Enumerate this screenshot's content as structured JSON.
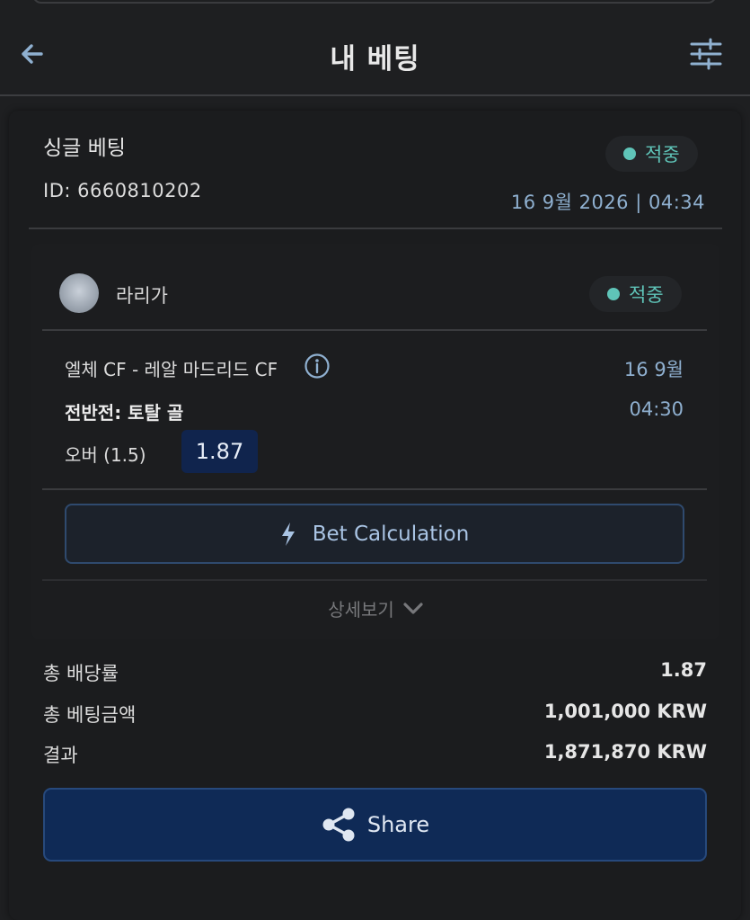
{
  "header": {
    "title": "내 베팅"
  },
  "bet": {
    "type": "싱글 베팅",
    "id": "ID: 6660810202",
    "status": "적중",
    "date": "16 9월 2026 | 04:34",
    "status_color": "#5fc4b8"
  },
  "event": {
    "league": "라리가",
    "status": "적중",
    "match": "엘체 CF - 레알 마드리드 CF",
    "date": "16 9월",
    "market": "전반전: 토탈 골",
    "time": "04:30",
    "selection": "오버 (1.5)",
    "odds": "1.87",
    "calc_label": "Bet Calculation",
    "details_label": "상세보기"
  },
  "summary": {
    "total_odds_label": "총 배당률",
    "total_odds_value": "1.87",
    "stake_label": "총 베팅금액",
    "stake_value": "1,001,000 KRW",
    "result_label": "결과",
    "result_value": "1,871,870 KRW"
  },
  "share": {
    "label": "Share"
  },
  "icons": [
    "back-arrow-icon",
    "filter-sliders-icon",
    "info-icon",
    "lightning-icon",
    "chevron-down-icon",
    "share-icon"
  ]
}
